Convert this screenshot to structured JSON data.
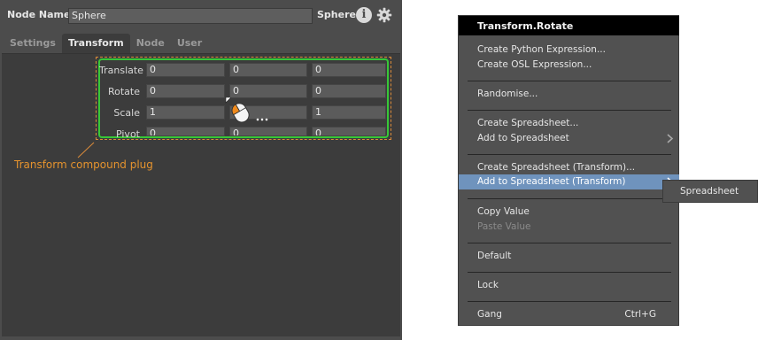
{
  "editor": {
    "node_name_label": "Node Name",
    "node_name_value": "Sphere",
    "node_type": "Sphere",
    "info_glyph": "i",
    "tabs": [
      {
        "label": "Settings",
        "active": false
      },
      {
        "label": "Transform",
        "active": true
      },
      {
        "label": "Node",
        "active": false
      },
      {
        "label": "User",
        "active": false
      }
    ],
    "rows": [
      {
        "label": "Translate",
        "values": [
          "0",
          "0",
          "0"
        ]
      },
      {
        "label": "Rotate",
        "values": [
          "0",
          "0",
          "0"
        ]
      },
      {
        "label": "Scale",
        "values": [
          "1",
          "1",
          "1"
        ]
      },
      {
        "label": "Pivot",
        "values": [
          "0",
          "0",
          "0"
        ]
      }
    ],
    "annotation": "Transform compound plug",
    "colors": {
      "highlight_box": "#37c737",
      "dashed_box": "#d98a3a",
      "annotation": "#e5932e"
    }
  },
  "context_menu": {
    "title": "Transform.Rotate",
    "items": [
      {
        "label": "Create Python Expression...",
        "disabled": false
      },
      {
        "label": "Create OSL Expression...",
        "disabled": false
      },
      {
        "label": "Randomise...",
        "disabled": false
      },
      {
        "label": "Create Spreadsheet...",
        "disabled": false
      },
      {
        "label": "Add to Spreadsheet",
        "disabled": false,
        "submenu": true
      },
      {
        "label": "Create Spreadsheet (Transform)...",
        "disabled": false
      },
      {
        "label": "Add to Spreadsheet (Transform)",
        "disabled": false,
        "submenu": true,
        "highlighted": true
      },
      {
        "label": "Copy Value",
        "disabled": false
      },
      {
        "label": "Paste Value",
        "disabled": true
      },
      {
        "label": "Default",
        "disabled": false
      },
      {
        "label": "Lock",
        "disabled": false
      },
      {
        "label": "Gang",
        "disabled": false,
        "shortcut": "Ctrl+G"
      }
    ],
    "submenu_item": "Spreadsheet",
    "highlight_color": "#6f93bd"
  },
  "icons": {
    "info": "info-icon",
    "settings": "gear-icon",
    "cursor": "mouse-left-click-icon",
    "submenu": "chevron-right-icon"
  }
}
